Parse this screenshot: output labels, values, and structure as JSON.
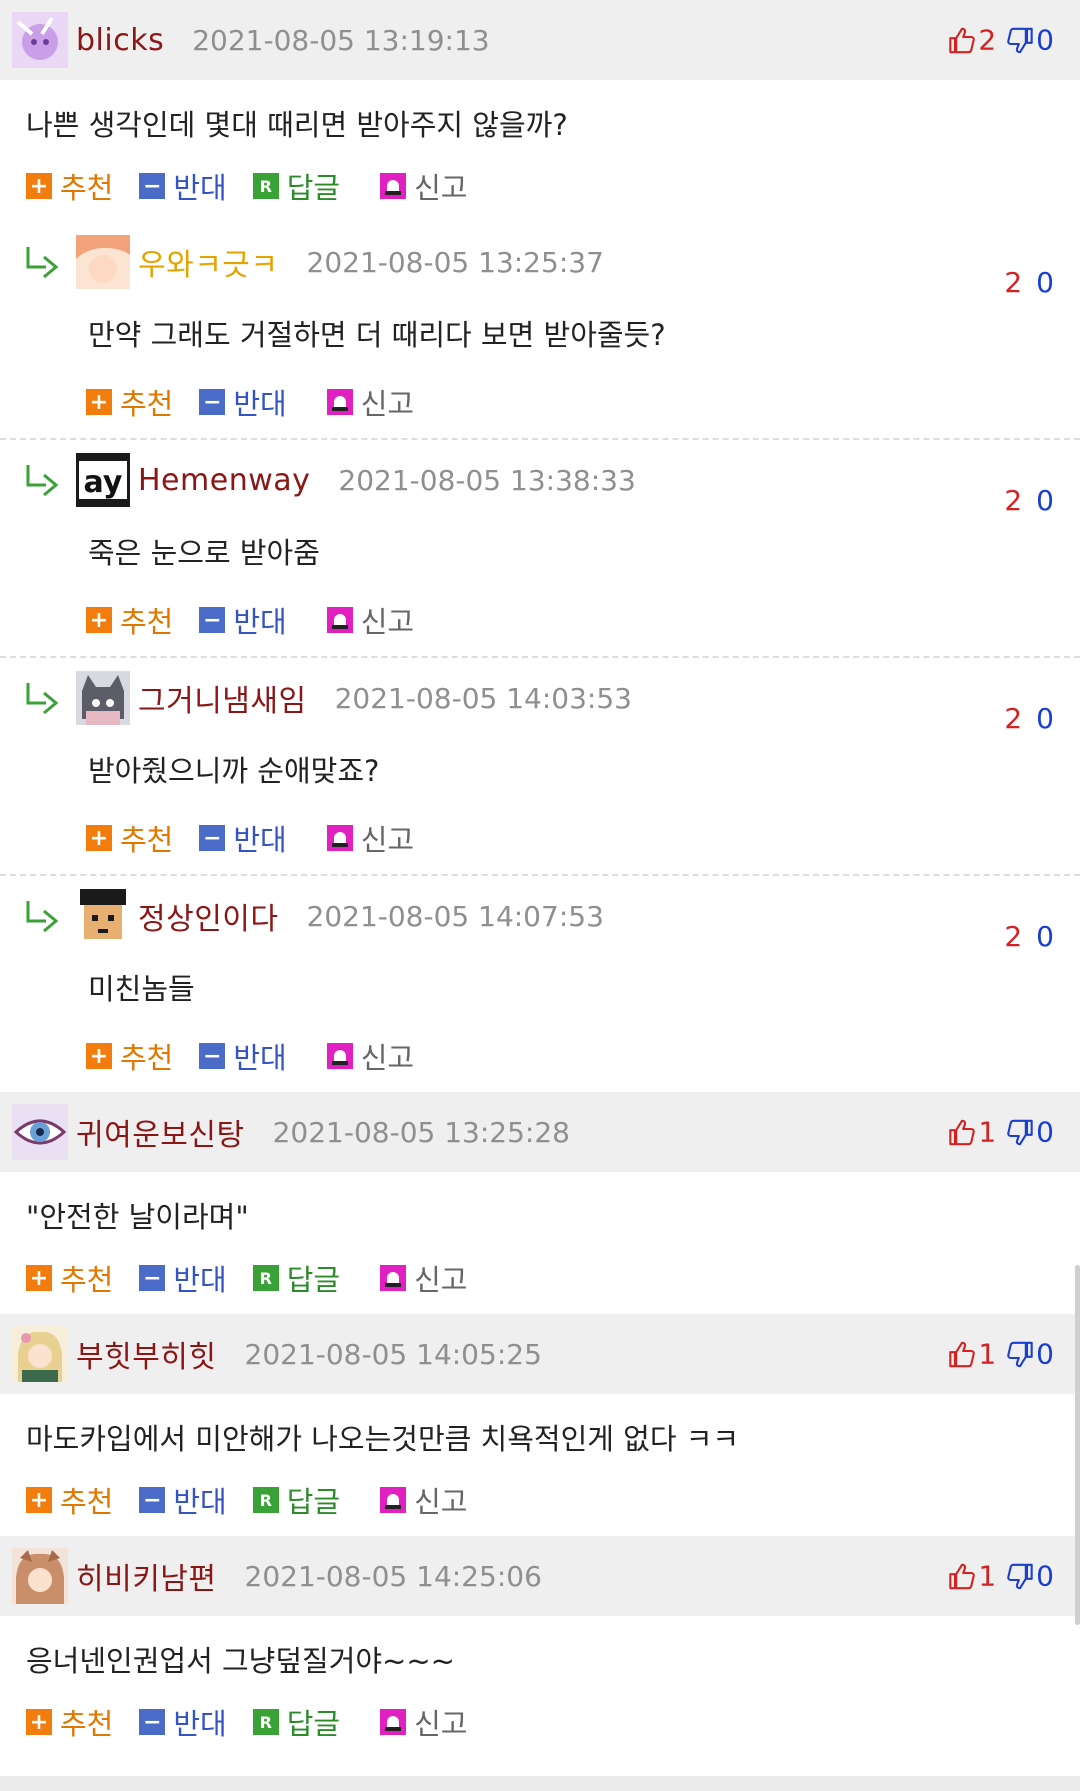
{
  "actions": {
    "recommend": "추천",
    "oppose": "반대",
    "reply": "답글",
    "report": "신고",
    "reply_icon_letter": "R"
  },
  "comments": [
    {
      "type": "top",
      "nick": "blicks",
      "time": "2021-08-05 13:19:13",
      "up": "2",
      "down": "0",
      "text": "나쁜 생각인데 몇대 때리면 받아주지 않을까?",
      "avatar_color": "#c9a0e8"
    },
    {
      "type": "reply",
      "nick": "우와ㅋ긋ㅋ",
      "time": "2021-08-05 13:25:37",
      "up": "2",
      "down": "0",
      "text": "만약 그래도 거절하면 더 때리다 보면 받아줄듯?",
      "avatar_color": "#f3c9a5"
    },
    {
      "type": "reply",
      "nick": "Hemenway",
      "time": "2021-08-05 13:38:33",
      "up": "2",
      "down": "0",
      "text": "죽은 눈으로 받아줌",
      "avatar_text": "ay"
    },
    {
      "type": "reply",
      "nick": "그거니냄새임",
      "time": "2021-08-05 14:03:53",
      "up": "2",
      "down": "0",
      "text": "받아줬으니까 순애맞죠?",
      "avatar_color": "#7a7a86"
    },
    {
      "type": "reply",
      "nick": "정상인이다",
      "time": "2021-08-05 14:07:53",
      "up": "2",
      "down": "0",
      "text": "미친놈들",
      "avatar_color": "#e8b070"
    },
    {
      "type": "top",
      "nick": "귀여운보신탕",
      "time": "2021-08-05 13:25:28",
      "up": "1",
      "down": "0",
      "text": "\"안전한 날이라며\"",
      "avatar_color": "#b8a6d8"
    },
    {
      "type": "top",
      "nick": "부힛부히힛",
      "time": "2021-08-05 14:05:25",
      "up": "1",
      "down": "0",
      "text": "마도카입에서 미안해가 나오는것만큼 치욕적인게 없다 ㅋㅋ",
      "avatar_color": "#e8d090"
    },
    {
      "type": "top",
      "nick": "히비키남편",
      "time": "2021-08-05 14:25:06",
      "up": "1",
      "down": "0",
      "text": "응너넨인권업서 그냥덮질거야~~~",
      "avatar_color": "#c98f6a"
    }
  ]
}
